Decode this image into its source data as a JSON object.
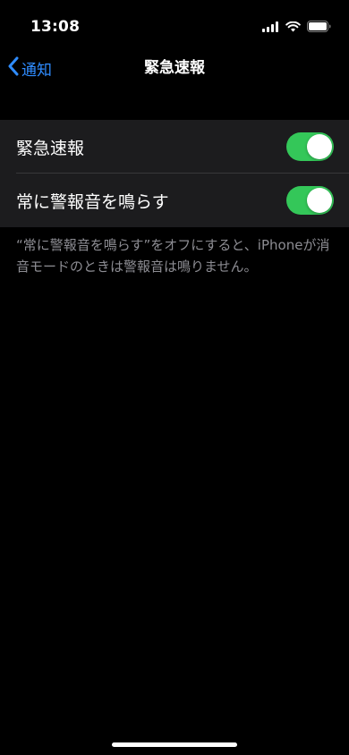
{
  "status_bar": {
    "time": "13:08",
    "icons": [
      "cellular-signal-icon",
      "wifi-icon",
      "battery-icon"
    ]
  },
  "nav": {
    "back_label": "通知",
    "title": "緊急速報"
  },
  "settings": {
    "rows": [
      {
        "label": "緊急速報",
        "toggle_on": true
      },
      {
        "label": "常に警報音を鳴らす",
        "toggle_on": true
      }
    ]
  },
  "footer": {
    "note": "“常に警報音を鳴らす”をオフにすると、iPhoneが消音モードのときは警報音は鳴りません。"
  },
  "colors": {
    "accent": "#2f8cff",
    "toggle_on": "#34c759",
    "background": "#000000",
    "group_background": "#1c1c1e",
    "secondary_text": "#8d8d93"
  }
}
